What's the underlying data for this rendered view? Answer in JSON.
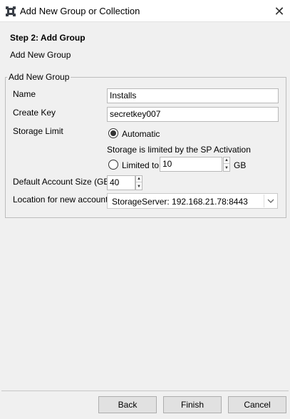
{
  "window": {
    "title": "Add New Group or Collection",
    "close_glyph": "✕"
  },
  "step": {
    "title": "Step 2: Add Group",
    "subtitle": "Add New Group"
  },
  "group": {
    "legend": "Add New Group",
    "name_label": "Name",
    "name_value": "Installs",
    "key_label": "Create Key",
    "key_value": "secretkey007",
    "storage_label": "Storage Limit",
    "automatic_label": "Automatic",
    "automatic_selected": true,
    "storage_note": "Storage is limited by the SP Activation",
    "limited_label": "Limited to",
    "limited_value": "10",
    "limited_unit": "GB",
    "default_size_label": "Default Account Size (GB)",
    "default_size_value": "40",
    "location_label": "Location for new accounts",
    "location_value": "StorageServer: 192.168.21.78:8443"
  },
  "buttons": {
    "back": "Back",
    "finish": "Finish",
    "cancel": "Cancel"
  },
  "icons": {
    "app": "app-logo-icon",
    "close": "close-icon",
    "spin_up": "spin-up-icon",
    "spin_down": "spin-down-icon",
    "dropdown": "chevron-down-icon"
  }
}
